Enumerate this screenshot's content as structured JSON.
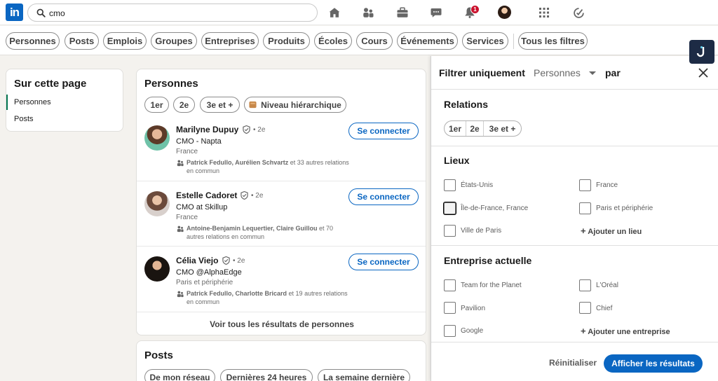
{
  "topnav": {
    "logo_text": "in",
    "search_value": "cmo",
    "icons": [
      "home-icon",
      "network-icon",
      "jobs-icon",
      "messaging-icon",
      "notifications-icon",
      "avatar",
      "grid-icon",
      "premium-icon"
    ],
    "notification_count": "1"
  },
  "pills": [
    "Personnes",
    "Posts",
    "Emplois",
    "Groupes",
    "Entreprises",
    "Produits",
    "Écoles",
    "Cours",
    "Événements",
    "Services",
    "Tous les filtres"
  ],
  "sidebar": {
    "title": "Sur cette page",
    "items": [
      "Personnes",
      "Posts"
    ]
  },
  "people": {
    "title": "Personnes",
    "chips": [
      "1er",
      "2e",
      "3e et +",
      "Niveau hiérarchique"
    ],
    "connect_label": "Se connecter",
    "results": [
      {
        "name": "Marilyne Dupuy",
        "degree": "• 2e",
        "headline": "CMO - Napta",
        "location": "France",
        "mutual_names": "Patrick Fedullo, Aurélien Schvartz",
        "mutual_rest": " et 33 autres relations en commun"
      },
      {
        "name": "Estelle Cadoret",
        "degree": "• 2e",
        "headline": "CMO at Skillup",
        "location": "France",
        "mutual_names": "Antoine-Benjamin Lequertier, Claire Guillou",
        "mutual_rest": " et 70 autres relations en commun"
      },
      {
        "name": "Célia Viejo",
        "degree": "• 2e",
        "headline": "CMO @AlphaEdge",
        "location": "Paris et périphérie",
        "mutual_names": "Patrick Fedullo, Charlotte Bricard",
        "mutual_rest": " et 19 autres relations en commun"
      }
    ],
    "see_all": "Voir tous les résultats de personnes"
  },
  "posts": {
    "title": "Posts",
    "chips": [
      "De mon réseau",
      "Dernières 24 heures",
      "La semaine dernière"
    ]
  },
  "panel": {
    "title": "Filtrer uniquement",
    "select_value": "Personnes",
    "par": "par",
    "relations_title": "Relations",
    "relations": [
      "1er",
      "2e",
      "3e et +"
    ],
    "lieux_title": "Lieux",
    "lieux": [
      "États-Unis",
      "France",
      "Île-de-France, France",
      "Paris et périphérie",
      "Ville de Paris"
    ],
    "add_lieu": "Ajouter un lieu",
    "entreprise_title": "Entreprise actuelle",
    "entreprises": [
      "Team for the Planet",
      "L'Oréal",
      "Pavilion",
      "Chief",
      "Google"
    ],
    "add_entreprise": "Ajouter une entreprise",
    "reset": "Réinitialiser",
    "show": "Afficher les résultats"
  },
  "colors": {
    "brand": "#0a66c2",
    "notification": "#cb112d",
    "ext_badge": "#1d2b45"
  }
}
